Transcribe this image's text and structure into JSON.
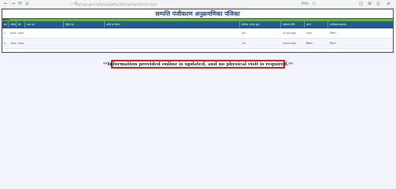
{
  "browser": {
    "back_icon": "back-arrow-icon",
    "forward_icon": "forward-arrow-icon",
    "reload_icon": "reload-icon",
    "home_icon": "home-icon",
    "url": "igrsup.gov.in/igrsupDefault/PropertySearch.aspx",
    "zoom": "90%"
  },
  "report": {
    "title": "सम्पत्ति पंजीकरण अनुक्रमणिका पंजिका",
    "strip_label": "क्रम सं.",
    "headers": [
      "क्रम",
      "पंजीकरण सं.",
      "वर्ष",
      "प्रथम पक्ष",
      "द्वितीय पक्ष",
      "संपत्ति का विवरण",
      "प्रतिफल / बाजार मूल्य",
      "पंजीकरण तिथि",
      "स्टाम्प",
      "उपनिबंधक कार्यालय"
    ],
    "rows": [
      {
        "sno": "1",
        "reg_no": "2524",
        "year": "2021",
        "first_party": "",
        "second_party": "",
        "property": "",
        "consideration": "25/-",
        "date": "11-02-2021",
        "stamp": "100/-",
        "office": "विवरण"
      },
      {
        "sno": "2",
        "reg_no": "3647",
        "year": "2021",
        "first_party": "",
        "second_party": "",
        "property": "",
        "consideration": "75/-",
        "date": "24-03-2021",
        "stamp": "विवरण",
        "office": "विवरण"
      }
    ]
  },
  "notice": {
    "prefix": "**",
    "text": "Information provided online is updated, and no physical visit is required.",
    "suffix": "**"
  }
}
